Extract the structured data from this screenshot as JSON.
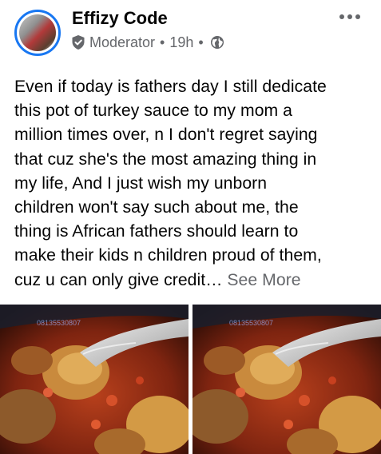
{
  "post": {
    "author": "Effizy Code",
    "role": "Moderator",
    "time": "19h",
    "separator": "•",
    "icons": {
      "role": "shield-check-icon",
      "privacy": "globe-icon",
      "menu": "more-horizontal-icon"
    },
    "text_lines": [
      "Even if today is fathers day I still dedicate",
      "this pot of turkey sauce to my mom a",
      "million times over, n I don't regret saying",
      "that cuz she's the most amazing thing in",
      "my life, And I just wish my unborn",
      "children won't say such about me, the",
      "thing is African fathers should learn to",
      "make their kids n children proud of them,",
      "cuz u can only give credit…"
    ],
    "see_more": "See More"
  },
  "photos": [
    {
      "watermark": "08135530807"
    },
    {
      "watermark": "08135530807"
    }
  ],
  "colors": {
    "accent": "#1877f2",
    "text": "#050505",
    "secondary": "#65676b"
  }
}
